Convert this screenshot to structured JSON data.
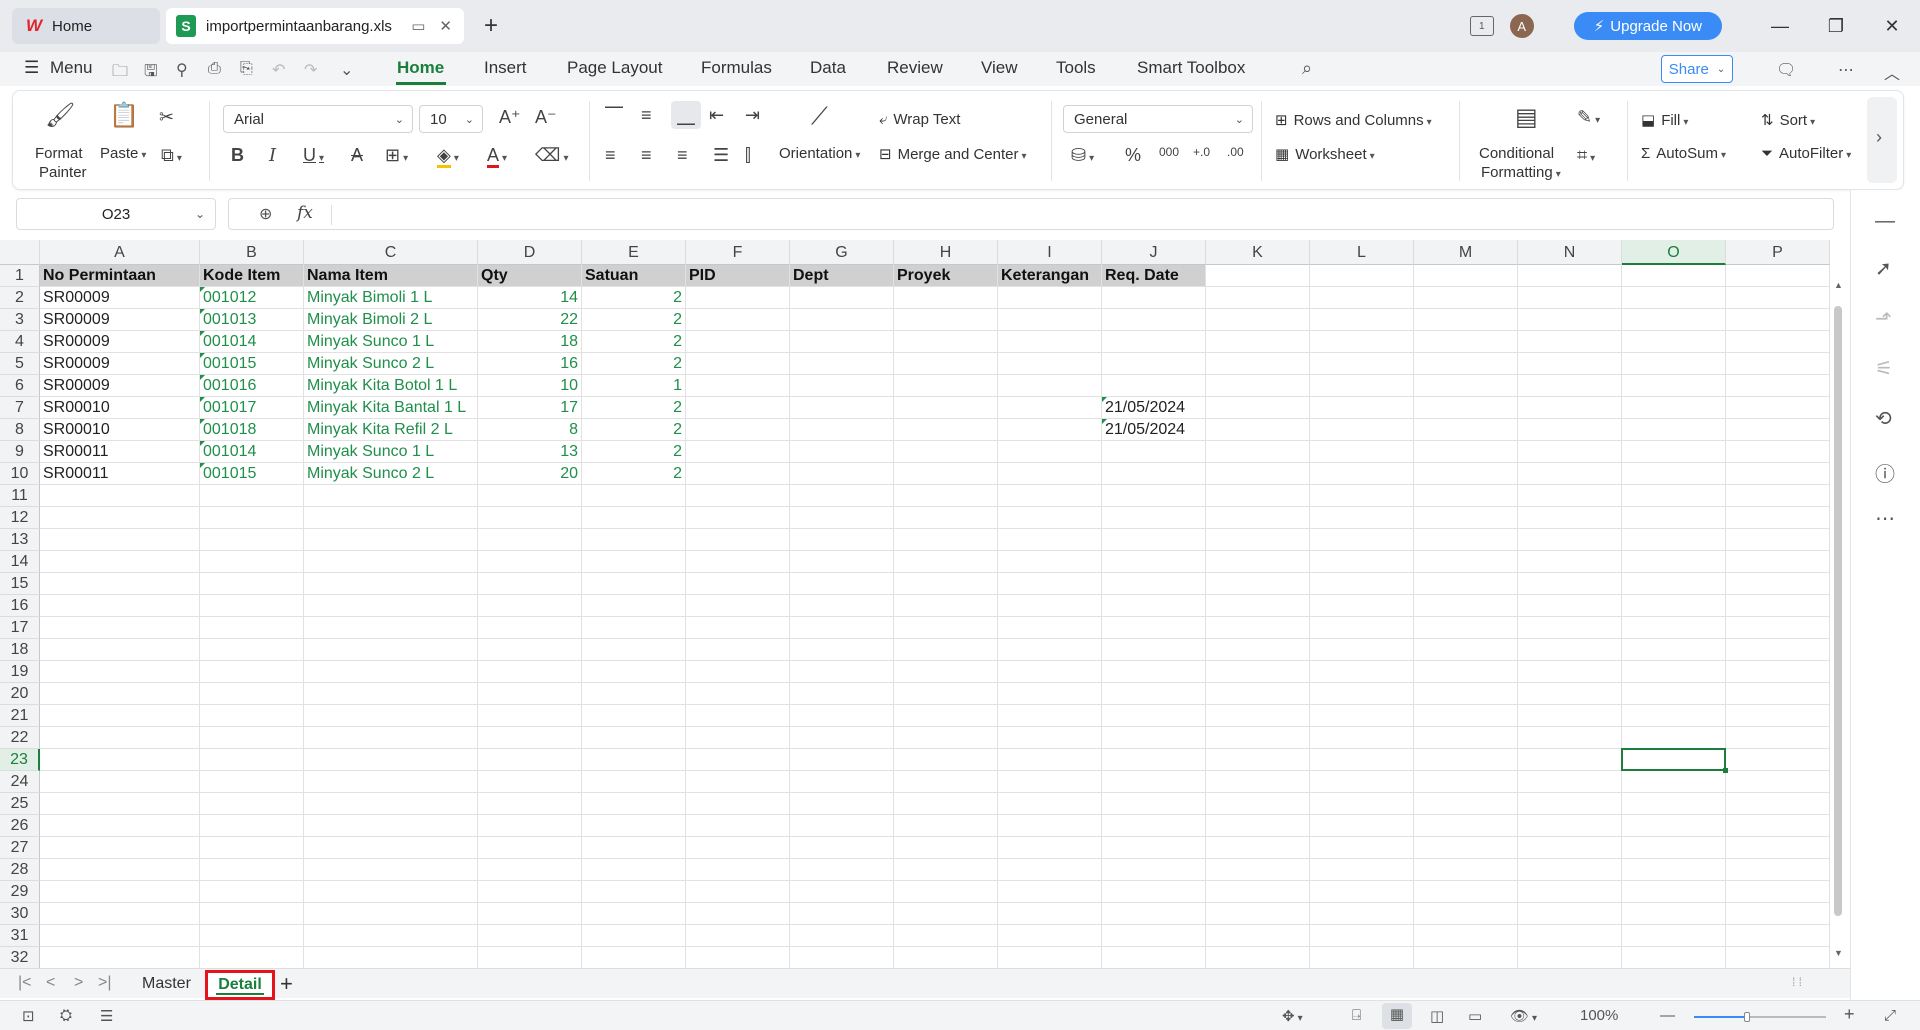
{
  "titlebar": {
    "home_tab": "Home",
    "file_tab": "importpermintaanbarang.xls",
    "avatar_initial": "A",
    "upgrade_label": "Upgrade Now",
    "window_badge": "1"
  },
  "menubar": {
    "menu_label": "Menu",
    "tabs": [
      "Home",
      "Insert",
      "Page Layout",
      "Formulas",
      "Data",
      "Review",
      "View",
      "Tools",
      "Smart Toolbox"
    ],
    "share_label": "Share"
  },
  "ribbon": {
    "format_painter_line1": "Format",
    "format_painter_line2": "Painter",
    "paste_label": "Paste",
    "font_name": "Arial",
    "font_size": "10",
    "wrap_text": "Wrap Text",
    "merge_center": "Merge and Center",
    "orientation": "Orientation",
    "number_format": "General",
    "rows_columns": "Rows and Columns",
    "worksheet": "Worksheet",
    "conditional_line1": "Conditional",
    "conditional_line2": "Formatting",
    "fill": "Fill",
    "autosum": "AutoSum",
    "sort": "Sort",
    "autofilter": "AutoFilter"
  },
  "formula_bar": {
    "name_box": "O23",
    "fx_label": "fx",
    "content": ""
  },
  "sheet": {
    "columns": [
      "A",
      "B",
      "C",
      "D",
      "E",
      "F",
      "G",
      "H",
      "I",
      "J",
      "K",
      "L",
      "M",
      "N",
      "O",
      "P"
    ],
    "active_column": "O",
    "active_row": 23,
    "row_count": 32,
    "headers": [
      "No Permintaan",
      "Kode Item",
      "Nama Item",
      "Qty",
      "Satuan",
      "PID",
      "Dept",
      "Proyek",
      "Keterangan",
      "Req. Date"
    ],
    "rows": [
      [
        "SR00009",
        "001012",
        "Minyak Bimoli 1 L",
        "14",
        "2",
        "",
        "",
        "",
        "",
        ""
      ],
      [
        "SR00009",
        "001013",
        "Minyak Bimoli 2 L",
        "22",
        "2",
        "",
        "",
        "",
        "",
        ""
      ],
      [
        "SR00009",
        "001014",
        "Minyak Sunco 1 L",
        "18",
        "2",
        "",
        "",
        "",
        "",
        ""
      ],
      [
        "SR00009",
        "001015",
        "Minyak Sunco 2 L",
        "16",
        "2",
        "",
        "",
        "",
        "",
        ""
      ],
      [
        "SR00009",
        "001016",
        "Minyak Kita Botol 1 L",
        "10",
        "1",
        "",
        "",
        "",
        "",
        ""
      ],
      [
        "SR00010",
        "001017",
        "Minyak Kita Bantal 1 L",
        "17",
        "2",
        "",
        "",
        "",
        "",
        "21/05/2024"
      ],
      [
        "SR00010",
        "001018",
        "Minyak Kita Refil 2 L",
        "8",
        "2",
        "",
        "",
        "",
        "",
        "21/05/2024"
      ],
      [
        "SR00011",
        "001014",
        "Minyak Sunco 1 L",
        "13",
        "2",
        "",
        "",
        "",
        "",
        ""
      ],
      [
        "SR00011",
        "001015",
        "Minyak Sunco 2 L",
        "20",
        "2",
        "",
        "",
        "",
        "",
        ""
      ]
    ]
  },
  "sheet_tabs": {
    "tabs": [
      "Master",
      "Detail"
    ],
    "active": "Detail"
  },
  "statusbar": {
    "zoom": "100%",
    "zoom_level_percent": 40
  },
  "colors": {
    "accent_green": "#1a7f3c",
    "text_green": "#1f8f4a",
    "upgrade_blue": "#3a8bf5",
    "highlight_red": "#e3141c"
  }
}
